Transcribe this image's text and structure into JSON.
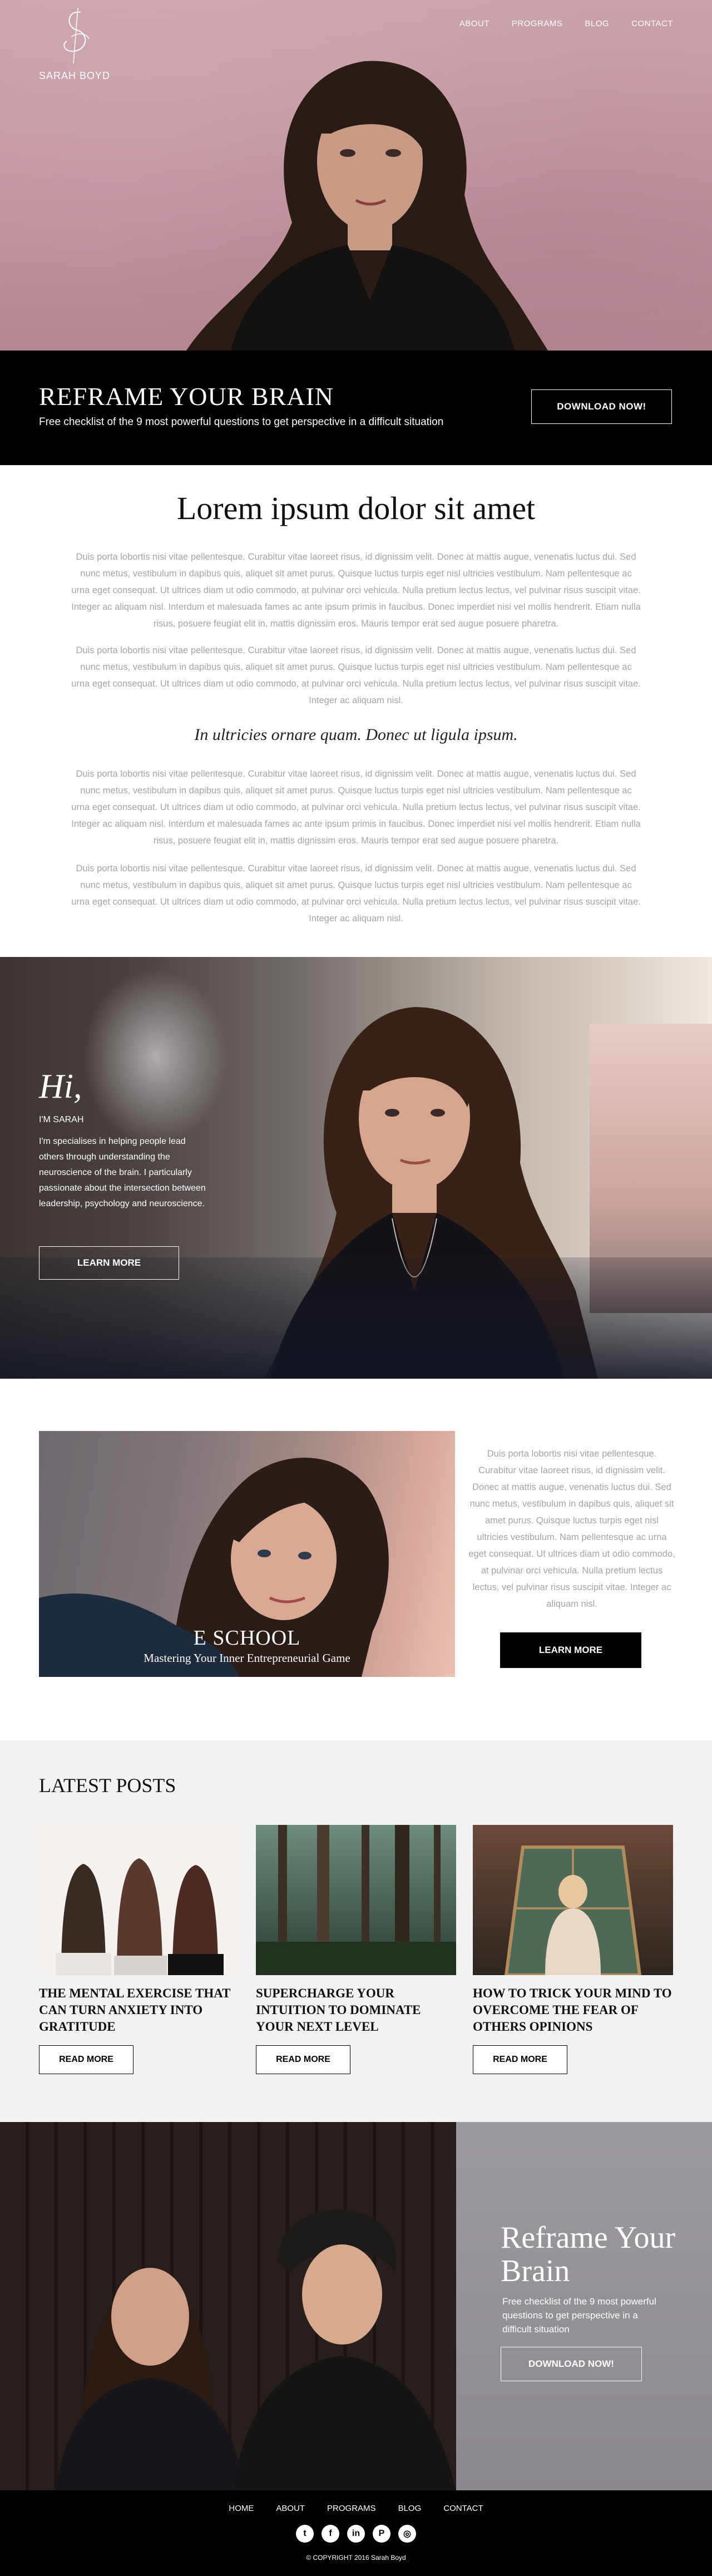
{
  "brand": {
    "name": "SARAH BOYD",
    "accent": "#000000",
    "hero_bg": "#c79ca6"
  },
  "nav": [
    {
      "label": "ABOUT"
    },
    {
      "label": "PROGRAMS"
    },
    {
      "label": "BLOG"
    },
    {
      "label": "CONTACT"
    }
  ],
  "band": {
    "title": "REFRAME YOUR BRAIN",
    "subtitle": "Free checklist of the 9 most powerful questions to get perspective in a difficult situation",
    "button": "DOWNLOAD NOW!"
  },
  "article": {
    "title": "Lorem ipsum dolor sit amet",
    "paragraphs": [
      "Duis porta lobortis nisi vitae pellentesque. Curabitur vitae laoreet risus, id dignissim velit. Donec at mattis augue, venenatis luctus dui. Sed nunc metus, vestibulum in dapibus quis, aliquet sit amet purus. Quisque luctus turpis eget nisl ultricies vestibulum. Nam pellentesque ac urna eget consequat. Ut ultrices diam ut odio commodo, at pulvinar orci vehicula. Nulla pretium lectus lectus, vel pulvinar risus suscipit vitae. Integer ac aliquam nisl. Interdum et malesuada fames ac ante ipsum primis in faucibus. Donec imperdiet nisi vel mollis hendrerit. Etiam nulla risus, posuere feugiat elit in, mattis dignissim eros. Mauris tempor erat sed augue posuere pharetra.",
      "Duis porta lobortis nisi vitae pellentesque. Curabitur vitae laoreet risus, id dignissim velit. Donec at mattis augue, venenatis luctus dui. Sed nunc metus, vestibulum in dapibus quis, aliquet sit amet purus. Quisque luctus turpis eget nisl ultricies vestibulum. Nam pellentesque ac urna eget consequat. Ut ultrices diam ut odio commodo, at pulvinar orci vehicula. Nulla pretium lectus lectus, vel pulvinar risus suscipit vitae. Integer ac aliquam nisl.",
      "Duis porta lobortis nisi vitae pellentesque. Curabitur vitae laoreet risus, id dignissim velit. Donec at mattis augue, venenatis luctus dui. Sed nunc metus, vestibulum in dapibus quis, aliquet sit amet purus. Quisque luctus turpis eget nisl ultricies vestibulum. Nam pellentesque ac urna eget consequat. Ut ultrices diam ut odio commodo, at pulvinar orci vehicula. Nulla pretium lectus lectus, vel pulvinar risus suscipit vitae. Integer ac aliquam nisl. Interdum et malesuada fames ac ante ipsum primis in faucibus. Donec imperdiet nisi vel mollis hendrerit. Etiam nulla risus, posuere feugiat elit in, mattis dignissim eros. Mauris tempor erat sed augue posuere pharetra.",
      "Duis porta lobortis nisi vitae pellentesque. Curabitur vitae laoreet risus, id dignissim velit. Donec at mattis augue, venenatis luctus dui. Sed nunc metus, vestibulum in dapibus quis, aliquet sit amet purus. Quisque luctus turpis eget nisl ultricies vestibulum. Nam pellentesque ac urna eget consequat. Ut ultrices diam ut odio commodo, at pulvinar orci vehicula. Nulla pretium lectus lectus, vel pulvinar risus suscipit vitae. Integer ac aliquam nisl."
    ],
    "subheading": "In ultricies ornare quam. Donec ut ligula ipsum."
  },
  "hi": {
    "title": "Hi,",
    "subtitle": "I'M SARAH",
    "bio": "I'm specialises in helping people lead others through understanding the neuroscience of the brain. I particularly passionate about the intersection between leadership, psychology and neuroscience.",
    "button": "LEARN MORE"
  },
  "eschool": {
    "title": "E SCHOOL",
    "subtitle": "Mastering Your Inner Entrepreneurial Game",
    "text": "Duis porta lobortis nisi vitae pellentesque. Curabitur vitae laoreet risus, id dignissim velit. Donec at mattis augue, venenatis luctus dui. Sed nunc metus, vestibulum in dapibus quis, aliquet sit amet purus. Quisque luctus turpis eget nisl ultricies vestibulum. Nam pellentesque ac urna eget consequat. Ut ultrices diam ut odio commodo, at pulvinar orci vehicula. Nulla pretium lectus lectus, vel pulvinar risus suscipit vitae. Integer ac aliquam nisl.",
    "button": "LEARN MORE"
  },
  "posts": {
    "heading": "LATEST POSTS",
    "items": [
      {
        "title": "THE MENTAL EXERCISE THAT CAN TURN ANXIETY INTO GRATITUDE",
        "button": "READ MORE"
      },
      {
        "title": "SUPERCHARGE YOUR INTUITION TO DOMINATE YOUR NEXT LEVEL",
        "button": "READ MORE"
      },
      {
        "title": "HOW TO TRICK YOUR MIND TO OVERCOME THE FEAR OF OTHERS OPINIONS",
        "button": "READ MORE"
      }
    ]
  },
  "reframe": {
    "title": "Reframe Your Brain",
    "text": "Free checklist of the 9 most powerful questions to get perspective in a difficult situation",
    "button": "DOWNLOAD NOW!"
  },
  "footer": {
    "nav": [
      {
        "label": "HOME"
      },
      {
        "label": "ABOUT"
      },
      {
        "label": "PROGRAMS"
      },
      {
        "label": "BLOG"
      },
      {
        "label": "CONTACT"
      }
    ],
    "social": [
      {
        "icon": "twitter-icon",
        "glyph": "t"
      },
      {
        "icon": "facebook-icon",
        "glyph": "f"
      },
      {
        "icon": "linkedin-icon",
        "glyph": "in"
      },
      {
        "icon": "pinterest-icon",
        "glyph": "P"
      },
      {
        "icon": "rss-icon",
        "glyph": "◎"
      }
    ],
    "copyright": "© COPYRIGHT 2016 Sarah Boyd"
  }
}
